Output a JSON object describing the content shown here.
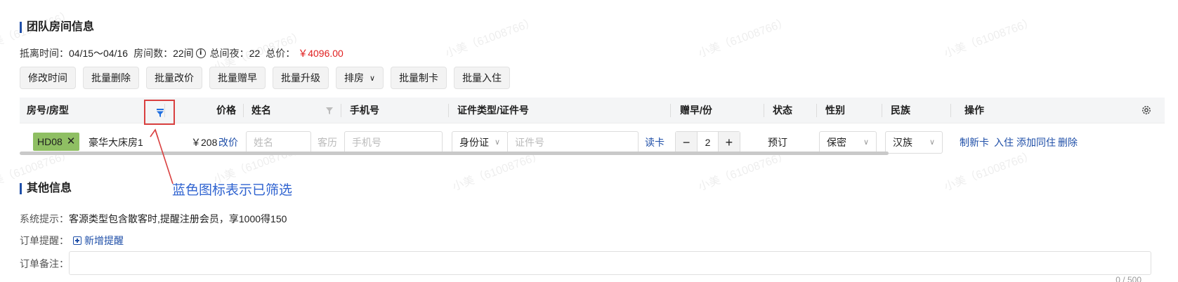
{
  "room_section": {
    "title": "团队房间信息",
    "summary": {
      "stay_label": "抵离时间：",
      "stay_value": "04/15～04/16",
      "rooms_label": "房间数：",
      "rooms_value": "22间",
      "info_icon": "i",
      "nights_label": "总间夜：",
      "nights_value": "22",
      "total_label": "总价：",
      "total_value": "￥4096.00"
    },
    "toolbar": {
      "buttons": [
        "修改时间",
        "批量删除",
        "批量改价",
        "批量赠早",
        "批量升级",
        "排房",
        "批量制卡",
        "批量入住"
      ],
      "dropdown_chevron": "∨"
    }
  },
  "table": {
    "columns": {
      "room": "房号/房型",
      "price": "价格",
      "name": "姓名",
      "phone": "手机号",
      "id": "证件类型/证件号",
      "breakfast": "赠早/份",
      "status": "状态",
      "gender": "性别",
      "ethnicity": "民族",
      "actions": "操作"
    },
    "row": {
      "room_no": "HD08",
      "remove_mark": "✕",
      "room_type": "豪华大床房1",
      "price": "￥208",
      "change_price": "改价",
      "name_placeholder": "姓名",
      "guest_history": "客历",
      "phone_placeholder": "手机号",
      "id_type": "身份证",
      "id_placeholder": "证件号",
      "read_card": "读卡",
      "breakfast_minus": "−",
      "breakfast_count": "2",
      "breakfast_plus": "+",
      "status": "预订",
      "gender": "保密",
      "ethnicity": "汉族",
      "action_make_card": "制新卡",
      "action_checkin": "入住",
      "action_add_companion": "添加同住",
      "action_delete": "删除"
    },
    "filter_active_color": "#1f6fe0",
    "filter_inactive_color": "#bbbbbb"
  },
  "annotation": {
    "text": "蓝色图标表示已筛选",
    "color": "#2f63d0",
    "arrow_color": "#d94040"
  },
  "other_section": {
    "title": "其他信息",
    "system_tip_label": "系统提示：",
    "system_tip_value": "客源类型包含散客时,提醒注册会员，享1000得150",
    "order_reminder_label": "订单提醒：",
    "add_reminder": "新增提醒",
    "order_note_label": "订单备注：",
    "note_counter": "0 / 500"
  },
  "watermark": "小美（61008766）",
  "colors": {
    "link": "#1f4fa8",
    "price_red": "#e02020",
    "tag_green": "#8fbf63"
  }
}
